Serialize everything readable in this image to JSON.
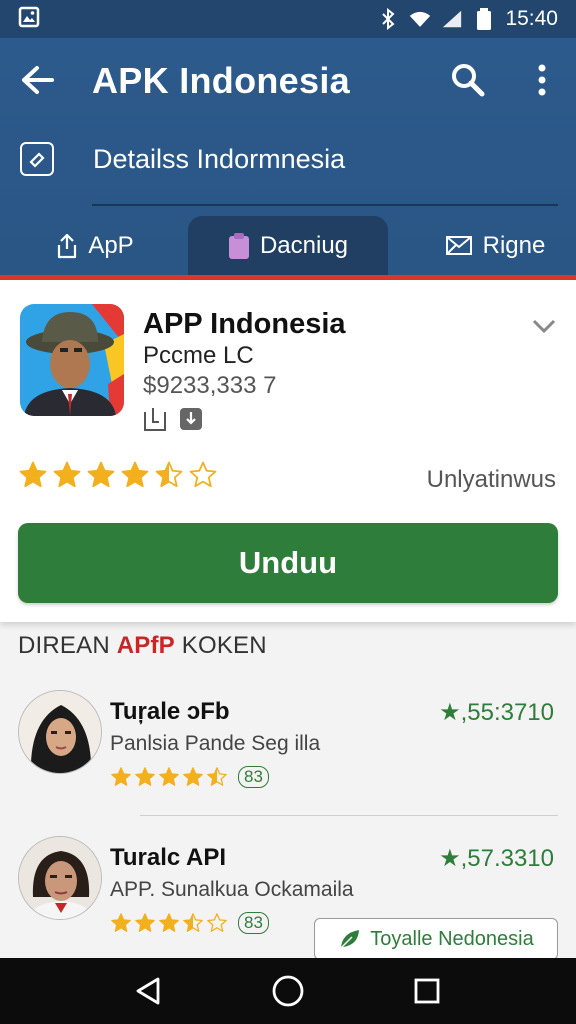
{
  "status_bar": {
    "time": "15:40"
  },
  "toolbar": {
    "title": "APK Indonesia"
  },
  "subheader": {
    "text": "Detailss Indormnesia"
  },
  "tabs": [
    {
      "label": "ApP",
      "icon": "share-icon",
      "active": false
    },
    {
      "label": "Dacniug",
      "icon": "clipboard-icon",
      "active": true
    },
    {
      "label": "Rigne",
      "icon": "mail-icon",
      "active": false
    }
  ],
  "app": {
    "name": "APP Indonesia",
    "developer": "Pccme LC",
    "price": "$9233,333 7",
    "rating": 4.5,
    "rating_label": "Unlyatinwus",
    "download_label": "Unduu"
  },
  "section": {
    "prefix": "DIREAN ",
    "accent": "APfP",
    "suffix": " KOKEN"
  },
  "reviews": [
    {
      "name": "Tuŗale ɔFb",
      "text": "Panlsia Pande Seg illa",
      "stars": 4.5,
      "count": "83",
      "score": "★,55:3710"
    },
    {
      "name": "Turalc API",
      "text": "APP. Sunalkua Ockamaila",
      "stars": 3.5,
      "count": "83",
      "score": "★,57.3310"
    }
  ],
  "chip": {
    "label": "Toyalle Nedonesia",
    "icon": "leaf-icon"
  },
  "colors": {
    "header": "#2c5a8c",
    "accent_red": "#d8382d",
    "green": "#2e7d3a",
    "star": "#f2b01e"
  }
}
